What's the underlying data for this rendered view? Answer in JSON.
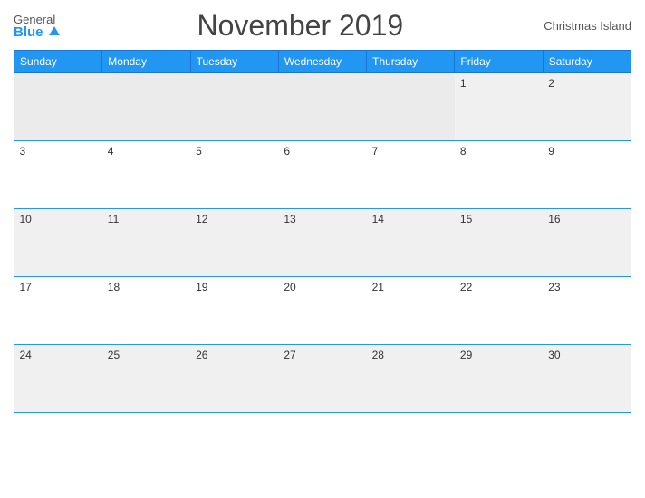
{
  "header": {
    "logo_general": "General",
    "logo_blue": "Blue",
    "title": "November 2019",
    "location": "Christmas Island"
  },
  "weekdays": [
    "Sunday",
    "Monday",
    "Tuesday",
    "Wednesday",
    "Thursday",
    "Friday",
    "Saturday"
  ],
  "weeks": [
    [
      {
        "day": "",
        "empty": true
      },
      {
        "day": "",
        "empty": true
      },
      {
        "day": "",
        "empty": true
      },
      {
        "day": "",
        "empty": true
      },
      {
        "day": "",
        "empty": true
      },
      {
        "day": "1",
        "empty": false
      },
      {
        "day": "2",
        "empty": false
      }
    ],
    [
      {
        "day": "3",
        "empty": false
      },
      {
        "day": "4",
        "empty": false
      },
      {
        "day": "5",
        "empty": false
      },
      {
        "day": "6",
        "empty": false
      },
      {
        "day": "7",
        "empty": false
      },
      {
        "day": "8",
        "empty": false
      },
      {
        "day": "9",
        "empty": false
      }
    ],
    [
      {
        "day": "10",
        "empty": false
      },
      {
        "day": "11",
        "empty": false
      },
      {
        "day": "12",
        "empty": false
      },
      {
        "day": "13",
        "empty": false
      },
      {
        "day": "14",
        "empty": false
      },
      {
        "day": "15",
        "empty": false
      },
      {
        "day": "16",
        "empty": false
      }
    ],
    [
      {
        "day": "17",
        "empty": false
      },
      {
        "day": "18",
        "empty": false
      },
      {
        "day": "19",
        "empty": false
      },
      {
        "day": "20",
        "empty": false
      },
      {
        "day": "21",
        "empty": false
      },
      {
        "day": "22",
        "empty": false
      },
      {
        "day": "23",
        "empty": false
      }
    ],
    [
      {
        "day": "24",
        "empty": false
      },
      {
        "day": "25",
        "empty": false
      },
      {
        "day": "26",
        "empty": false
      },
      {
        "day": "27",
        "empty": false
      },
      {
        "day": "28",
        "empty": false
      },
      {
        "day": "29",
        "empty": false
      },
      {
        "day": "30",
        "empty": false
      }
    ]
  ]
}
